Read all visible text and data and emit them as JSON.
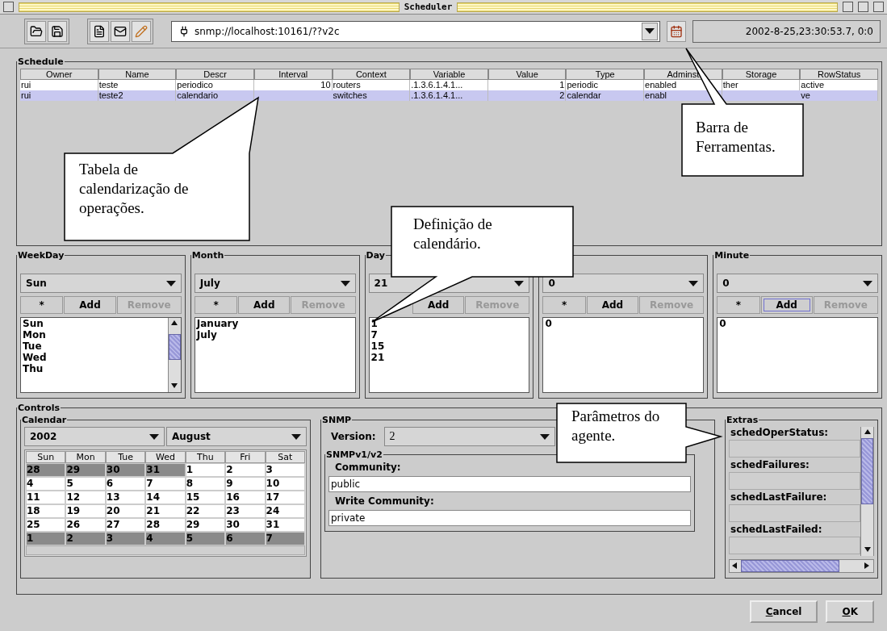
{
  "window": {
    "title": "Scheduler"
  },
  "toolbar": {
    "url": "snmp://localhost:10161/??v2c",
    "timestamp": "2002-8-25,23:30:53.7, 0:0"
  },
  "schedule": {
    "title": "Schedule",
    "columns": [
      {
        "label": "Owner",
        "numeric": false
      },
      {
        "label": "Name",
        "numeric": false
      },
      {
        "label": "Descr",
        "numeric": false
      },
      {
        "label": "Interval",
        "numeric": true
      },
      {
        "label": "Context",
        "numeric": false
      },
      {
        "label": "Variable",
        "numeric": false
      },
      {
        "label": "Value",
        "numeric": true
      },
      {
        "label": "Type",
        "numeric": false
      },
      {
        "label": "Adminst",
        "numeric": false
      },
      {
        "label": "Storage",
        "numeric": false
      },
      {
        "label": "RowStatus",
        "numeric": false
      }
    ],
    "rows": [
      {
        "selected": false,
        "cells": [
          "rui",
          "teste",
          "periodico",
          "10",
          "routers",
          ".1.3.6.1.4.1...",
          "1",
          "periodic",
          "enabled",
          "ther",
          "active"
        ]
      },
      {
        "selected": true,
        "cells": [
          "rui",
          "teste2",
          "calendario",
          null,
          "switches",
          ".1.3.6.1.4.1...",
          "2",
          "calendar",
          "enabl",
          null,
          "ve"
        ]
      }
    ]
  },
  "panels": [
    {
      "title": "WeekDay",
      "value": "Sun",
      "star": "*",
      "add": "Add",
      "remove": "Remove",
      "add_focused": false,
      "remove_disabled": true,
      "items": [
        "Sun",
        "Mon",
        "Tue",
        "Wed",
        "Thu"
      ]
    },
    {
      "title": "Month",
      "value": "July",
      "star": "*",
      "add": "Add",
      "remove": "Remove",
      "add_focused": false,
      "remove_disabled": true,
      "items": [
        "January",
        "July"
      ]
    },
    {
      "title": "Day",
      "value": "21",
      "add": "Add",
      "remove": "Remove",
      "add_focused": false,
      "remove_disabled": true,
      "items": [
        "1",
        "7",
        "15",
        "21"
      ]
    },
    {
      "value": "0",
      "star": "*",
      "add": "Add",
      "remove": "Remove",
      "add_focused": false,
      "remove_disabled": true,
      "items": [
        "0"
      ]
    },
    {
      "title": "Minute",
      "value": "0",
      "star": "*",
      "add": "Add",
      "remove": "Remove",
      "add_focused": true,
      "remove_disabled": true,
      "items": [
        "0"
      ]
    }
  ],
  "controls": {
    "title": "Controls",
    "calendar": {
      "title": "Calendar",
      "year": "2002",
      "month": "August",
      "weekdays": [
        "Sun",
        "Mon",
        "Tue",
        "Wed",
        "Thu",
        "Fri",
        "Sat"
      ],
      "weeks": [
        [
          {
            "day": "28",
            "outside": true
          },
          {
            "day": "29",
            "outside": true
          },
          {
            "day": "30",
            "outside": true
          },
          {
            "day": "31",
            "outside": true
          },
          {
            "day": "1",
            "outside": false
          },
          {
            "day": "2",
            "outside": false
          },
          {
            "day": "3",
            "outside": false
          }
        ],
        [
          {
            "day": "4",
            "outside": false
          },
          {
            "day": "5",
            "outside": false
          },
          {
            "day": "6",
            "outside": false
          },
          {
            "day": "7",
            "outside": false
          },
          {
            "day": "8",
            "outside": false
          },
          {
            "day": "9",
            "outside": false
          },
          {
            "day": "10",
            "outside": false
          }
        ],
        [
          {
            "day": "11",
            "outside": false
          },
          {
            "day": "12",
            "outside": false
          },
          {
            "day": "13",
            "outside": false
          },
          {
            "day": "14",
            "outside": false
          },
          {
            "day": "15",
            "outside": false
          },
          {
            "day": "16",
            "outside": false
          },
          {
            "day": "17",
            "outside": false
          }
        ],
        [
          {
            "day": "18",
            "outside": false
          },
          {
            "day": "19",
            "outside": false
          },
          {
            "day": "20",
            "outside": false
          },
          {
            "day": "21",
            "outside": false
          },
          {
            "day": "22",
            "outside": false
          },
          {
            "day": "23",
            "outside": false
          },
          {
            "day": "24",
            "outside": false
          }
        ],
        [
          {
            "day": "25",
            "outside": false
          },
          {
            "day": "26",
            "outside": false
          },
          {
            "day": "27",
            "outside": false
          },
          {
            "day": "28",
            "outside": false
          },
          {
            "day": "29",
            "outside": false
          },
          {
            "day": "30",
            "outside": false
          },
          {
            "day": "31",
            "outside": false
          }
        ],
        [
          {
            "day": "1",
            "outside": true
          },
          {
            "day": "2",
            "outside": true
          },
          {
            "day": "3",
            "outside": true
          },
          {
            "day": "4",
            "outside": true
          },
          {
            "day": "5",
            "outside": true
          },
          {
            "day": "6",
            "outside": true
          },
          {
            "day": "7",
            "outside": true
          }
        ]
      ]
    },
    "snmp": {
      "title": "SNMP",
      "version_label": "Version:",
      "version": "2",
      "group_title": "SNMPv1/v2",
      "community_label": "Community:",
      "community": "public",
      "write_label": "Write Community:",
      "write_community": "private"
    },
    "extras": {
      "title": "Extras",
      "fields": [
        {
          "label": "schedOperStatus:"
        },
        {
          "label": "schedFailures:"
        },
        {
          "label": "schedLastFailure:"
        },
        {
          "label": "schedLastFailed:"
        }
      ]
    }
  },
  "buttons": [
    {
      "label": "Cancel"
    },
    {
      "label": "OK"
    }
  ],
  "callouts": [
    {
      "text": "Tabela de calendarização de operações."
    },
    {
      "text": "Barra de Ferramentas."
    },
    {
      "text": "Definição de calendário."
    },
    {
      "text": "Parâmetros do agente."
    }
  ]
}
